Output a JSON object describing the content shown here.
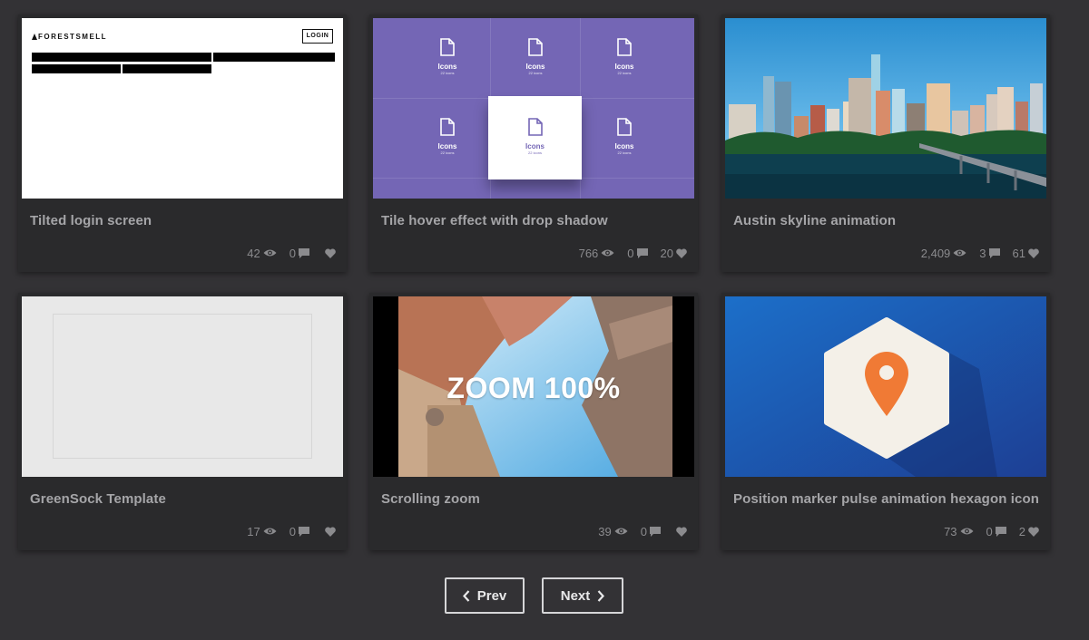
{
  "cards": [
    {
      "title": "Tilted login screen",
      "views": "42",
      "comments": "0",
      "likes": ""
    },
    {
      "title": "Tile hover effect with drop shadow",
      "views": "766",
      "comments": "0",
      "likes": "20"
    },
    {
      "title": "Austin skyline animation",
      "views": "2,409",
      "comments": "3",
      "likes": "61"
    },
    {
      "title": "GreenSock Template",
      "views": "17",
      "comments": "0",
      "likes": ""
    },
    {
      "title": "Scrolling zoom",
      "views": "39",
      "comments": "0",
      "likes": ""
    },
    {
      "title": "Position marker pulse animation hexagon icon",
      "views": "73",
      "comments": "0",
      "likes": "2"
    }
  ],
  "thumb1": {
    "brand": "FORESTSMELL",
    "login": "LOGIN"
  },
  "thumb2": {
    "tile_label": "Icons",
    "tile_sub": "22 icons"
  },
  "thumb5": {
    "overlay": "ZOOM 100%"
  },
  "pagination": {
    "prev": "Prev",
    "next": "Next"
  },
  "colors": {
    "background": "#333235",
    "card": "#2a2a2c",
    "purple": "#7466b5",
    "marker": "#f07a35",
    "blue": "#1f5fb4"
  }
}
